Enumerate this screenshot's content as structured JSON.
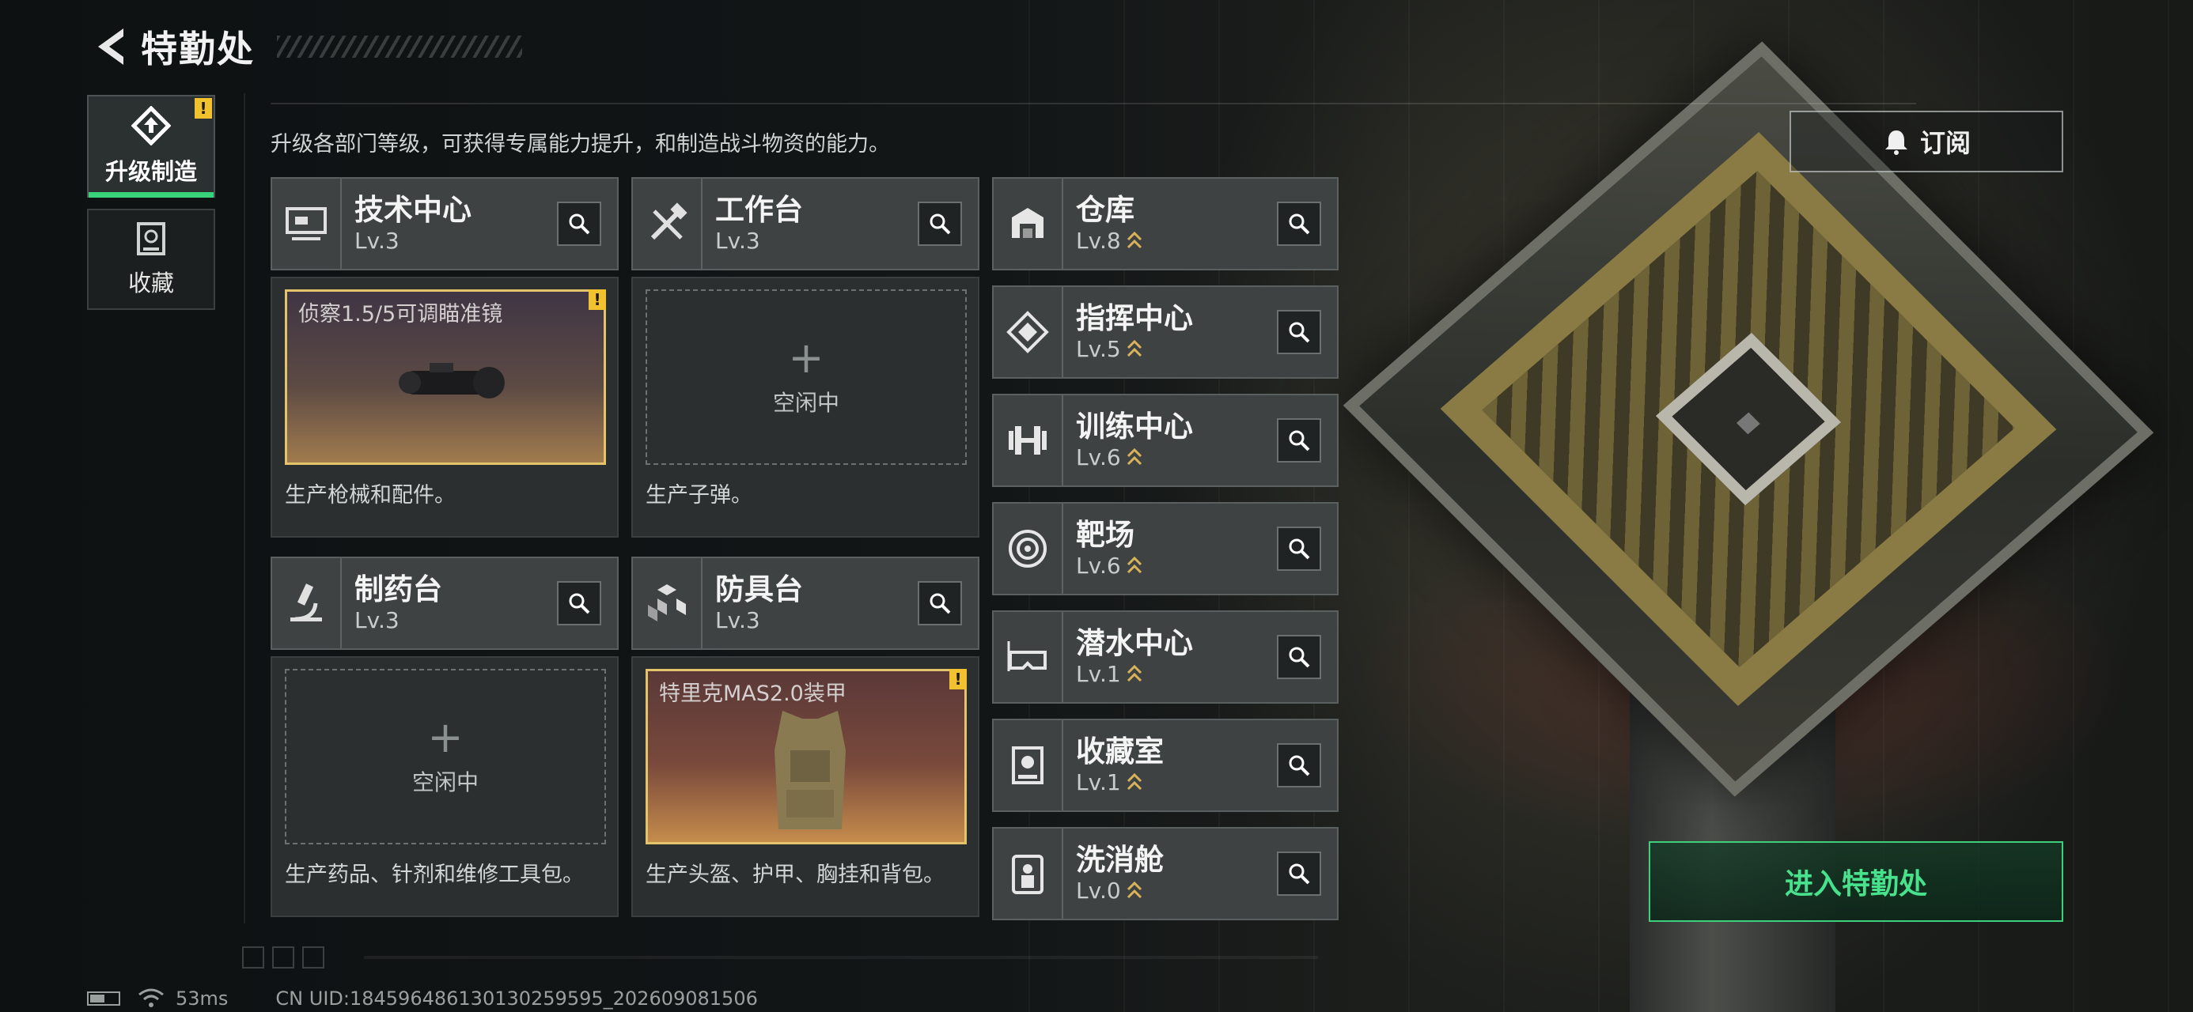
{
  "header": {
    "title": "特勤处"
  },
  "tabs": [
    {
      "label": "升级制造",
      "active": true,
      "alert": "!"
    },
    {
      "label": "收藏",
      "active": false
    }
  ],
  "description": "升级各部门等级，可获得专属能力提升，和制造战斗物资的能力。",
  "facilities": {
    "tech": {
      "name": "技术中心",
      "level": "Lv.3",
      "item": "侦察1.5/5可调瞄准镜",
      "alert": "!",
      "desc": "生产枪械和配件。"
    },
    "workbench": {
      "name": "工作台",
      "level": "Lv.3",
      "idle": "空闲中",
      "desc": "生产子弹。"
    },
    "pharmacy": {
      "name": "制药台",
      "level": "Lv.3",
      "idle": "空闲中",
      "desc": "生产药品、针剂和维修工具包。"
    },
    "armor": {
      "name": "防具台",
      "level": "Lv.3",
      "item": "特里克MAS2.0装甲",
      "alert": "!",
      "desc": "生产头盔、护甲、胸挂和背包。"
    }
  },
  "side_facilities": [
    {
      "name": "仓库",
      "level": "Lv.8",
      "icon": "warehouse-icon"
    },
    {
      "name": "指挥中心",
      "level": "Lv.5",
      "icon": "command-icon"
    },
    {
      "name": "训练中心",
      "level": "Lv.6",
      "icon": "dumbbell-icon"
    },
    {
      "name": "靶场",
      "level": "Lv.6",
      "icon": "target-icon"
    },
    {
      "name": "潜水中心",
      "level": "Lv.1",
      "icon": "diving-mask-icon"
    },
    {
      "name": "收藏室",
      "level": "Lv.1",
      "icon": "display-case-icon"
    },
    {
      "name": "洗消舱",
      "level": "Lv.0",
      "icon": "decon-icon"
    }
  ],
  "subscribe_label": "订阅",
  "enter_label": "进入特勤处",
  "status": {
    "ping": "53ms",
    "uid": "CN UID:18459648613013025959​5_202609081506"
  },
  "colors": {
    "accent_green": "#3ed07d",
    "alert_yellow": "#f2c12e",
    "level_chevron": "#d9b35a"
  }
}
